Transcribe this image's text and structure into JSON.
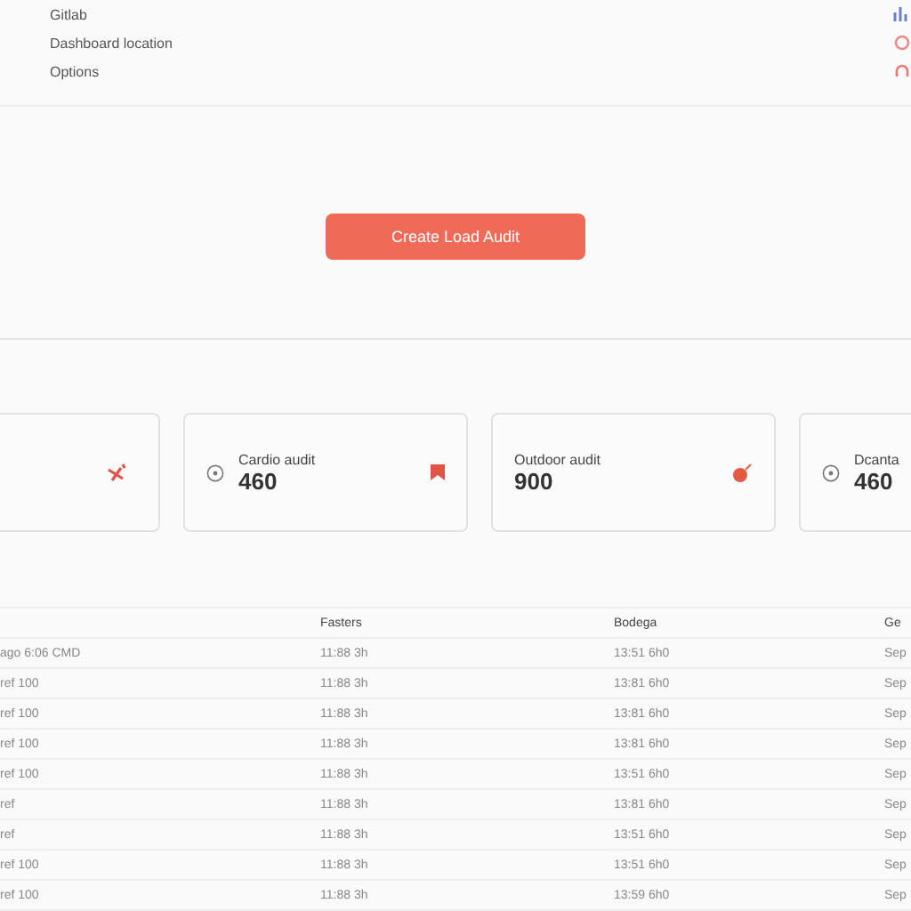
{
  "top_list": [
    {
      "label": "Gitlab"
    },
    {
      "label": "Dashboard location"
    },
    {
      "label": "Options"
    }
  ],
  "action_button": {
    "label": "Create Load Audit"
  },
  "cards": [
    {
      "kind": "icon_only"
    },
    {
      "kind": "stat",
      "label": "Cardio audit",
      "value": "460"
    },
    {
      "kind": "stat_plain",
      "label": "Outdoor audit",
      "value": "900"
    },
    {
      "kind": "stat",
      "label": "Dcanta",
      "value": "460"
    }
  ],
  "table": {
    "columns": [
      "",
      "Fasters",
      "Bodega",
      "Ge"
    ],
    "rows": [
      [
        "ago 6:06 CMD",
        "11:88 3h",
        "13:51 6h0",
        "Sep"
      ],
      [
        "ref 100",
        "11:88 3h",
        "13:81 6h0",
        "Sep"
      ],
      [
        "ref 100",
        "11:88 3h",
        "13:81 6h0",
        "Sep"
      ],
      [
        "ref 100",
        "11:88 3h",
        "13:81 6h0",
        "Sep"
      ],
      [
        "ref 100",
        "11:88 3h",
        "13:51 6h0",
        "Sep"
      ],
      [
        "ref",
        "11:88 3h",
        "13:81 6h0",
        "Sep"
      ],
      [
        "ref",
        "11:88 3h",
        "13:51 6h0",
        "Sep"
      ],
      [
        "ref 100",
        "11:88 3h",
        "13:51 6h0",
        "Sep"
      ],
      [
        "ref 100",
        "11:88 3h",
        "13:59 6h0",
        "Sep"
      ]
    ]
  }
}
